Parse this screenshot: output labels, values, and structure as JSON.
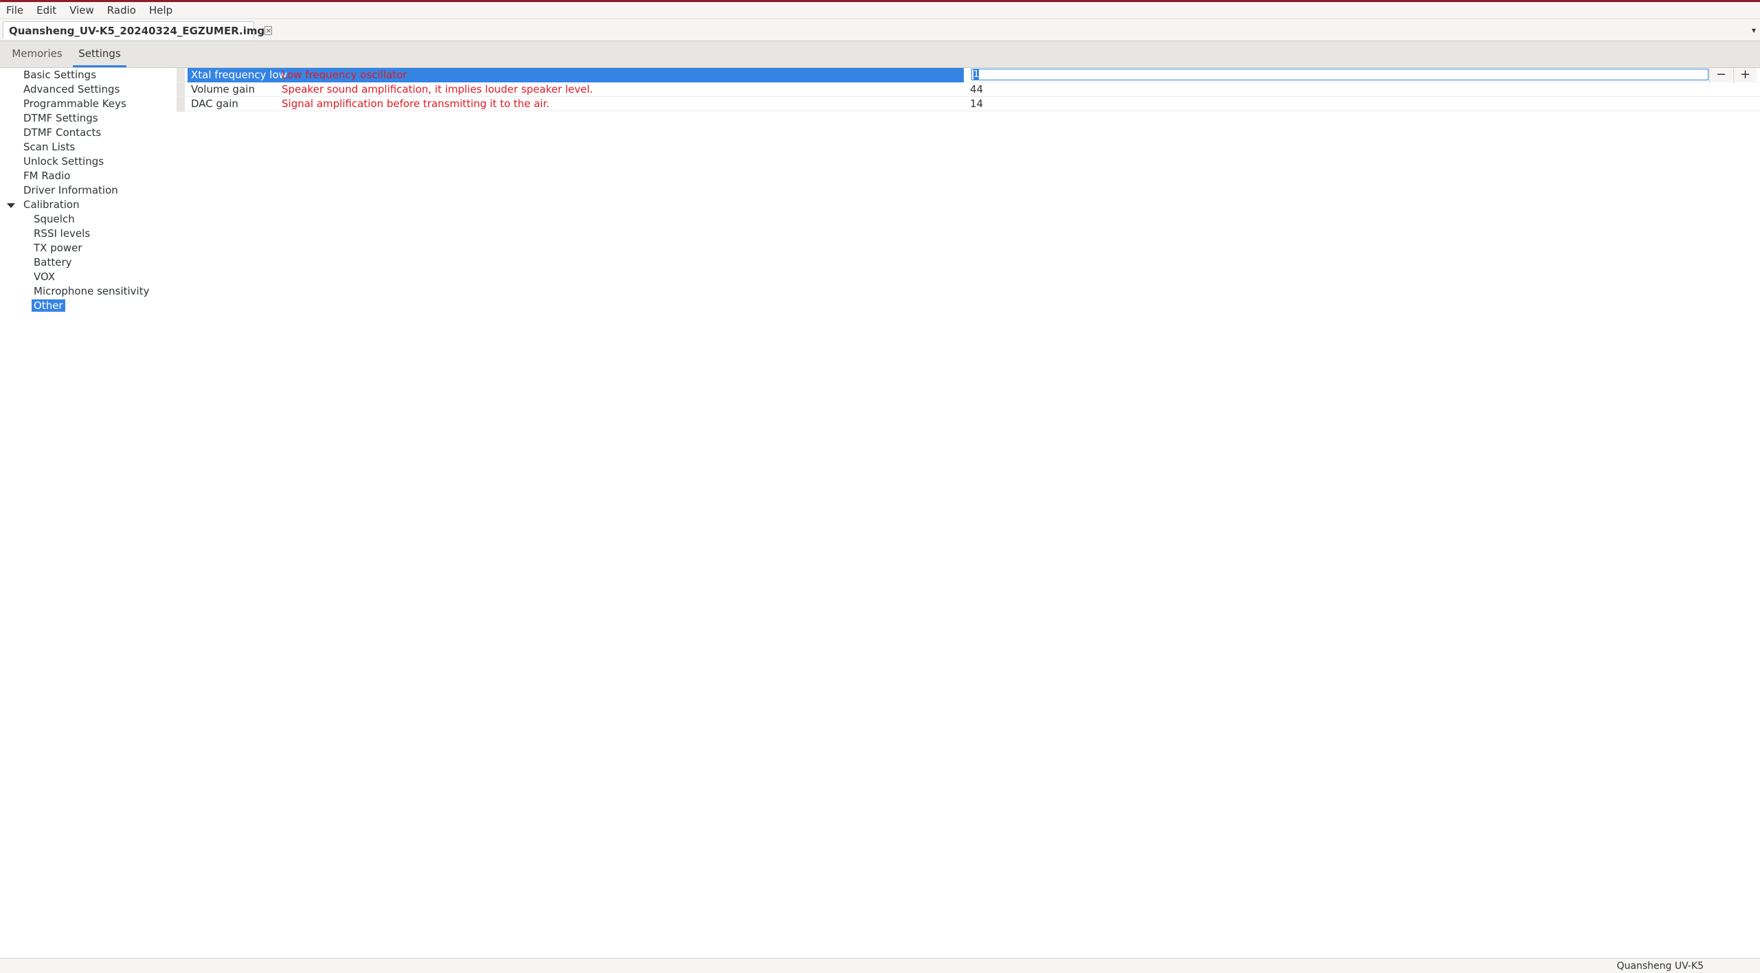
{
  "menu": [
    "File",
    "Edit",
    "View",
    "Radio",
    "Help"
  ],
  "document_tab": {
    "label": "Quansheng_UV-K5_20240324_EGZUMER.img",
    "close_glyph": "×",
    "overflow_glyph": "▾"
  },
  "notebook_tabs": [
    "Memories",
    "Settings"
  ],
  "tree": {
    "items": [
      "Basic Settings",
      "Advanced Settings",
      "Programmable Keys",
      "DTMF Settings",
      "DTMF Contacts",
      "Scan Lists",
      "Unlock Settings",
      "FM Radio",
      "Driver Information",
      "Calibration"
    ],
    "calibration_children": [
      "Squelch",
      "RSSI levels",
      "TX power",
      "Battery",
      "VOX",
      "Microphone sensitivity",
      "Other"
    ],
    "selected": "Other"
  },
  "settings": [
    {
      "name": "Xtal frequency low",
      "description": "Low frequency oscillator",
      "value": "1"
    },
    {
      "name": "Volume gain",
      "description": "Speaker sound amplification, it implies louder speaker level.",
      "value": "44"
    },
    {
      "name": "DAC gain",
      "description": "Signal amplification before transmitting it to the air.",
      "value": "14"
    }
  ],
  "spin": {
    "minus": "−",
    "plus": "+"
  },
  "status": {
    "text": "Quansheng UV-K5"
  },
  "colors": {
    "accent": "#3584e4",
    "description_text": "#e01b24",
    "window_border": "#8b1e2a"
  }
}
